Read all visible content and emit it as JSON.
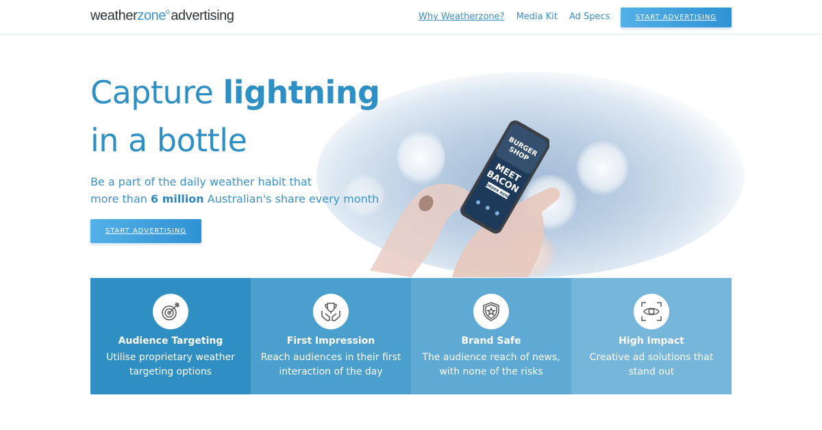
{
  "header": {
    "logo_weather": "weather",
    "logo_zone": "zone",
    "logo_deg": "o",
    "logo_advertising": "advertising",
    "nav": [
      "Why Weatherzone?",
      "Media Kit",
      "Ad Specs"
    ],
    "cta": "START ADVERTISING"
  },
  "hero": {
    "title_line1_a": "Capture ",
    "title_line1_b": "lightning",
    "title_line2": "in a bottle",
    "sub_line1": "Be a part of the daily weather habit that",
    "sub_line2_a": "more than ",
    "sub_line2_b": "6 million",
    "sub_line2_c": " Australian's share every month",
    "cta": "START ADVERTISING",
    "phone_ad_text": [
      "BURGER",
      "SHOP",
      "MEET",
      "BACON",
      "ORDER NOW"
    ]
  },
  "features": [
    {
      "icon": "target-icon",
      "title": "Audience Targeting",
      "desc": "Utilise proprietary weather targeting options"
    },
    {
      "icon": "trophy-hands-icon",
      "title": "First Impression",
      "desc": "Reach audiences in their first interaction of the day"
    },
    {
      "icon": "shield-star-icon",
      "title": "Brand Safe",
      "desc": "The audience reach of news, with none of the risks"
    },
    {
      "icon": "eye-focus-icon",
      "title": "High Impact",
      "desc": "Creative ad solutions that stand out"
    }
  ],
  "colors": {
    "brand_blue": "#2e8fc4",
    "feature_bg": [
      "#2f8fc2",
      "#4a9fcc",
      "#5eaad5",
      "#75b6da"
    ]
  }
}
